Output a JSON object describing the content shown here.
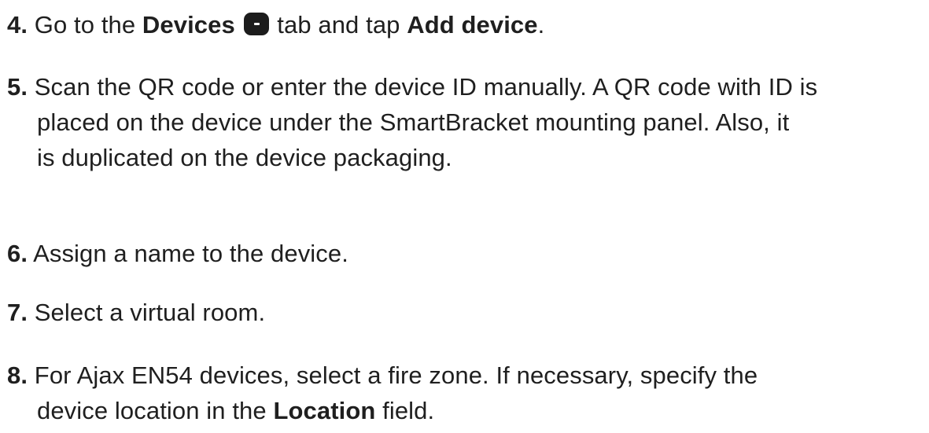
{
  "steps": [
    {
      "number": "4.",
      "text_before": "Go to the ",
      "bold_1": "Devices",
      "icon": "devices-tab-icon",
      "text_middle": " tab and tap ",
      "bold_2": "Add device",
      "text_after": "."
    },
    {
      "number": "5.",
      "line_1": "Scan the QR code or enter the device ID manually. A QR code with ID is",
      "line_2": "placed on the device under the SmartBracket mounting panel. Also, it",
      "line_3": "is duplicated on the device packaging."
    },
    {
      "number": "6.",
      "text": "Assign a name to the device."
    },
    {
      "number": "7.",
      "text": "Select a virtual room."
    },
    {
      "number": "8.",
      "line_1": "For Ajax EN54 devices, select a fire zone. If necessary, specify the",
      "line_2_before": "device location in the ",
      "line_2_bold": "Location",
      "line_2_after": " field."
    }
  ]
}
